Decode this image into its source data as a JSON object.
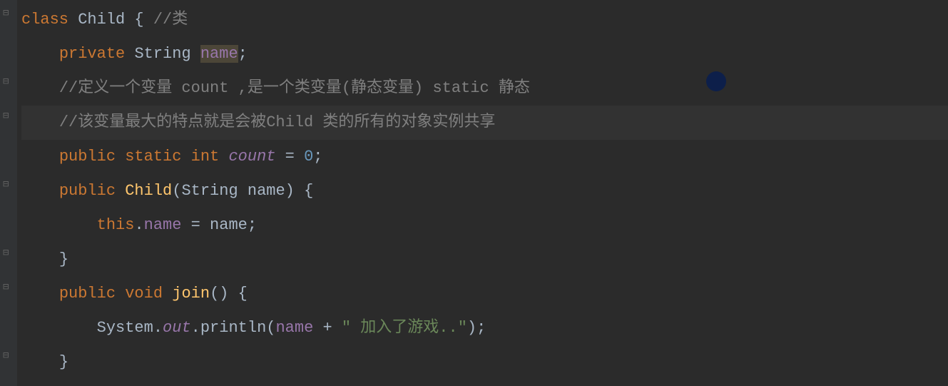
{
  "code": {
    "l1": {
      "kw_class": "class",
      "cls": "Child",
      "brace": " { ",
      "comment": "//类"
    },
    "l2": {
      "kw_priv": "private",
      "type": "String",
      "field": "name",
      "semi": ";"
    },
    "l3": {
      "comment": "//定义一个变量 count ,是一个类变量(静态变量) static 静态"
    },
    "l4": {
      "comment": "//该变量最大的特点就是会被Child 类的所有的对象实例共享"
    },
    "l5": {
      "kw_pub": "public",
      "kw_static": "static",
      "kw_int": "int",
      "var": "count",
      "eq": " = ",
      "num": "0",
      "semi": ";"
    },
    "l6": {
      "kw_pub": "public",
      "ctor": "Child",
      "params": "(String name) {"
    },
    "l7": {
      "kw_this": "this",
      "dot": ".",
      "field": "name",
      "eq": " = name;"
    },
    "l8": {
      "brace": "}"
    },
    "l9": {
      "kw_pub": "public",
      "kw_void": "void",
      "method": "join",
      "params": "() {"
    },
    "l10": {
      "sys": "System.",
      "out": "out",
      "print": ".println(",
      "field": "name",
      "plus": " + ",
      "str": "\" 加入了游戏..\"",
      "end": ");"
    },
    "l11": {
      "brace": "}"
    }
  }
}
